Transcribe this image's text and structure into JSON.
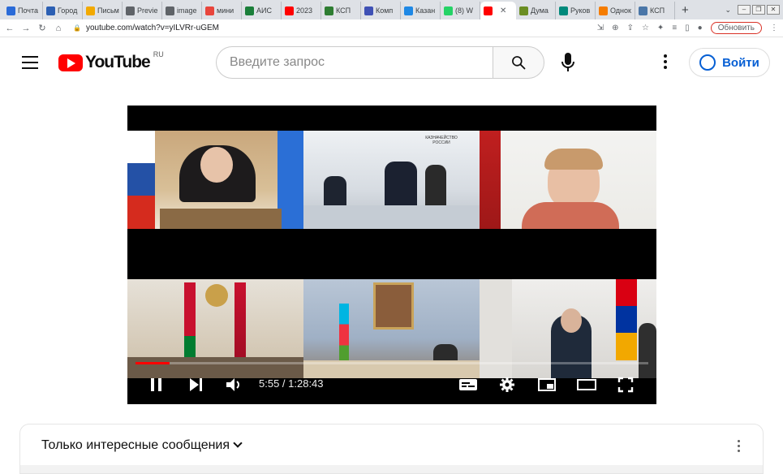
{
  "browser": {
    "tabs": [
      {
        "label": "Почта",
        "color": "#2a6bd8"
      },
      {
        "label": "Город",
        "color": "#2b5fb3"
      },
      {
        "label": "Письм",
        "color": "#f2a900"
      },
      {
        "label": "Previe",
        "color": "#5f6368"
      },
      {
        "label": "image",
        "color": "#5f6368"
      },
      {
        "label": "мини",
        "color": "#e8453c"
      },
      {
        "label": "АИС",
        "color": "#1b7f3a"
      },
      {
        "label": "2023",
        "color": "#ff0000"
      },
      {
        "label": "КСП",
        "color": "#2e7d32"
      },
      {
        "label": "Комп",
        "color": "#3f51b5"
      },
      {
        "label": "Казан",
        "color": "#1e88e5"
      },
      {
        "label": "(8) W",
        "color": "#25d366"
      },
      {
        "label": "",
        "color": "#ff0000"
      },
      {
        "label": "Дума",
        "color": "#6b8e23"
      },
      {
        "label": "Руков",
        "color": "#00897b"
      },
      {
        "label": "Однок",
        "color": "#f57c00"
      },
      {
        "label": "КСП",
        "color": "#4a76a8"
      }
    ],
    "url": "youtube.com/watch?v=yILVRr-uGEM",
    "update_label": "Обновить"
  },
  "youtube": {
    "logo_text": "YouTube",
    "country_code": "RU",
    "search_placeholder": "Введите запрос",
    "signin_label": "Войти"
  },
  "player": {
    "time_display": "5:55 / 1:28:43",
    "progress_fraction": 0.067,
    "org_sign": "КАЗНАЧЕЙСТВО РОССИИ"
  },
  "chat": {
    "title": "Только интересные сообщения"
  },
  "colors": {
    "youtube_red": "#ff0000",
    "link_blue": "#065fd4"
  }
}
